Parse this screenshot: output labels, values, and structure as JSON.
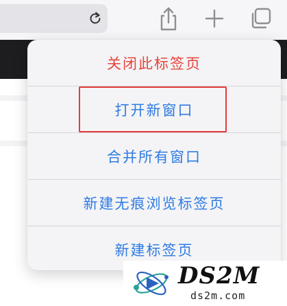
{
  "toolbar": {
    "reload_icon": "reload-icon",
    "share_icon": "share-icon",
    "new_tab_icon": "plus-icon",
    "tabs_icon": "tabs-overview-icon"
  },
  "menu": {
    "items": [
      {
        "label": "关闭此标签页",
        "role": "destructive",
        "color": "#e8433a"
      },
      {
        "label": "打开新窗口",
        "role": "normal",
        "color": "#2f7be4",
        "highlighted": true
      },
      {
        "label": "合并所有窗口",
        "role": "normal",
        "color": "#2f7be4"
      },
      {
        "label": "新建无痕浏览标签页",
        "role": "normal",
        "color": "#2f7be4"
      },
      {
        "label": "新建标签页",
        "role": "normal",
        "color": "#2f7be4"
      }
    ],
    "highlight_color": "#e23a3a"
  },
  "watermark": {
    "title": "DS2M",
    "subtitle": "ds2m.com"
  }
}
